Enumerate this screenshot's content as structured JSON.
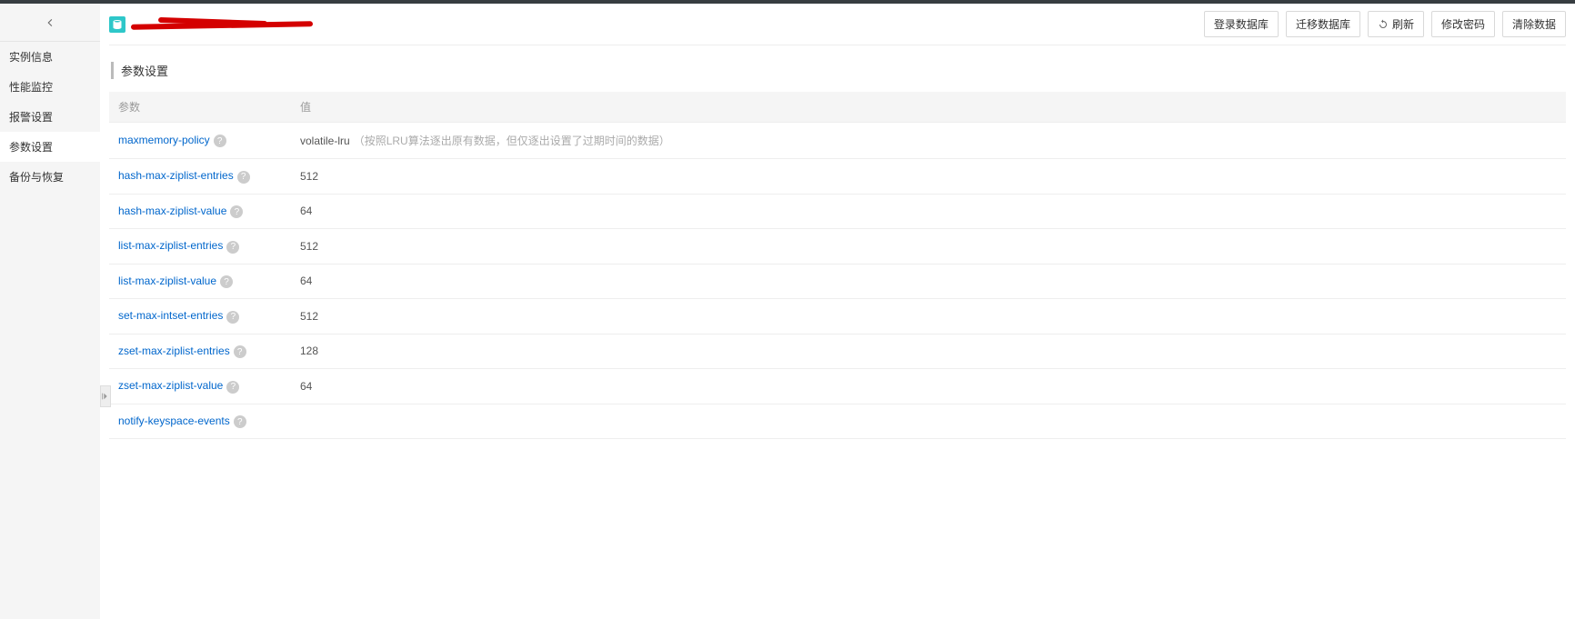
{
  "sidebar": {
    "items": [
      {
        "label": "实例信息"
      },
      {
        "label": "性能监控"
      },
      {
        "label": "报警设置"
      },
      {
        "label": "参数设置"
      },
      {
        "label": "备份与恢复"
      }
    ],
    "activeIndex": 3
  },
  "header": {
    "buttons": {
      "login_db": "登录数据库",
      "migrate_db": "迁移数据库",
      "refresh": "刷新",
      "change_pwd": "修改密码",
      "clear_data": "清除数据"
    }
  },
  "section": {
    "title": "参数设置"
  },
  "table": {
    "columns": {
      "param": "参数",
      "value": "值"
    },
    "rows": [
      {
        "name": "maxmemory-policy",
        "value": "volatile-lru",
        "note": "（按照LRU算法逐出原有数据，但仅逐出设置了过期时间的数据）"
      },
      {
        "name": "hash-max-ziplist-entries",
        "value": "512",
        "note": ""
      },
      {
        "name": "hash-max-ziplist-value",
        "value": "64",
        "note": ""
      },
      {
        "name": "list-max-ziplist-entries",
        "value": "512",
        "note": ""
      },
      {
        "name": "list-max-ziplist-value",
        "value": "64",
        "note": ""
      },
      {
        "name": "set-max-intset-entries",
        "value": "512",
        "note": ""
      },
      {
        "name": "zset-max-ziplist-entries",
        "value": "128",
        "note": ""
      },
      {
        "name": "zset-max-ziplist-value",
        "value": "64",
        "note": ""
      },
      {
        "name": "notify-keyspace-events",
        "value": "",
        "note": ""
      }
    ]
  }
}
